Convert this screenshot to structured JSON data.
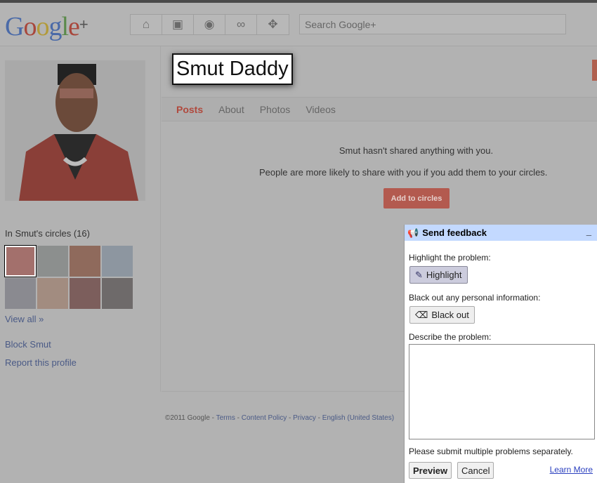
{
  "header": {
    "logo": "Google",
    "logo_plus": "+",
    "search_placeholder": "Search Google+",
    "nav_icons": [
      "home-icon",
      "photos-icon",
      "profile-icon",
      "circles-icon",
      "games-icon"
    ]
  },
  "profile": {
    "name": "Smut Daddy",
    "tabs": [
      {
        "label": "Posts",
        "active": true
      },
      {
        "label": "About"
      },
      {
        "label": "Photos"
      },
      {
        "label": "Videos"
      }
    ],
    "message1": "Smut hasn't shared anything with you.",
    "message2": "People are more likely to share with you if you add them to your circles.",
    "add_button": "Add to circles"
  },
  "sidebar": {
    "circles_title": "In Smut's circles (16)",
    "view_all": "View all »",
    "block": "Block Smut",
    "report": "Report this profile",
    "avatar_colors": [
      "#a3706c",
      "#8c8f8e",
      "#8f6a5c",
      "#8d96a0",
      "#8a8a90",
      "#a28c80",
      "#7c5e5c",
      "#6e6a6a"
    ]
  },
  "footer": {
    "copyright": "©2011 Google - ",
    "terms": "Terms",
    "sep": " - ",
    "content_policy": "Content Policy",
    "privacy": "Privacy",
    "language": "English (United States)"
  },
  "feedback": {
    "title": "Send feedback",
    "minimize": "_",
    "highlight_label": "Highlight the problem:",
    "highlight_button": "Highlight",
    "blackout_label": "Black out any personal information:",
    "blackout_button": "Black out",
    "describe_label": "Describe the problem:",
    "note": "Please submit multiple problems separately.",
    "preview": "Preview",
    "cancel": "Cancel",
    "learn_more": "Learn More"
  }
}
